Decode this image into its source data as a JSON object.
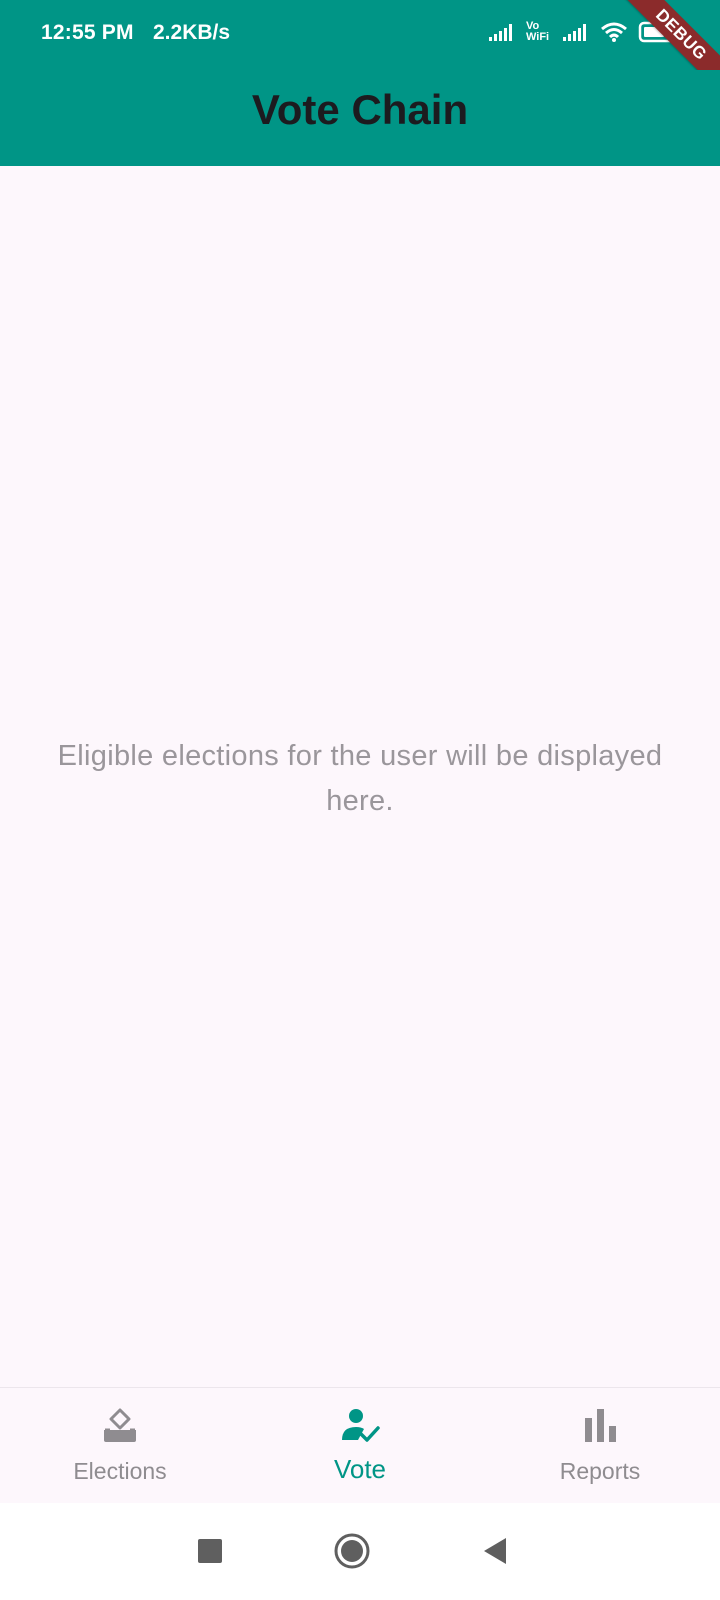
{
  "status_bar": {
    "time": "12:55 PM",
    "speed": "2.2KB/s",
    "vowifi": "Vo WiFi",
    "background": "#009586",
    "icons": [
      "signal-icon",
      "vowifi-icon",
      "signal-icon",
      "wifi-icon",
      "battery-icon"
    ]
  },
  "debug_banner": "DEBUG",
  "app_bar": {
    "title": "Vote Chain"
  },
  "main": {
    "empty_message": "Eligible elections for the user will be displayed here."
  },
  "bottom_nav": {
    "items": [
      {
        "label": "Elections",
        "icon": "ballot-icon",
        "active": false
      },
      {
        "label": "Vote",
        "icon": "person-check-icon",
        "active": true
      },
      {
        "label": "Reports",
        "icon": "bar-chart-icon",
        "active": false
      }
    ],
    "active_color": "#009586",
    "inactive_color": "#8f8c90"
  },
  "system_nav": {
    "buttons": [
      "recents-icon",
      "home-icon",
      "back-icon"
    ]
  }
}
